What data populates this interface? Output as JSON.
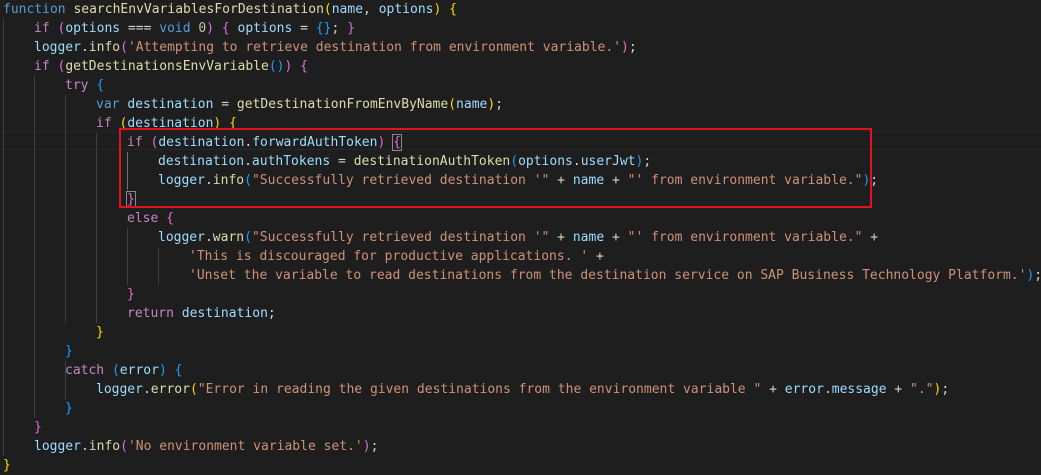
{
  "editor": {
    "theme": {
      "background": "#1e1e1e",
      "keyword": "#569cd6",
      "control": "#c586c0",
      "function": "#dcdcaa",
      "variable": "#9cdcfe",
      "string": "#ce9178",
      "number": "#b5cea8",
      "bracket_level_1": "#ffd700",
      "bracket_level_2": "#da70d6",
      "bracket_level_3": "#179fff",
      "annotation_box": "#e0141e"
    },
    "lines": [
      [
        [
          "kw",
          "function"
        ],
        [
          "p",
          " "
        ],
        [
          "fn",
          "searchEnvVariablesForDestination"
        ],
        [
          "b1",
          "("
        ],
        [
          "var",
          "name"
        ],
        [
          "p",
          ", "
        ],
        [
          "var",
          "options"
        ],
        [
          "b1",
          ")"
        ],
        [
          "p",
          " "
        ],
        [
          "b1",
          "{"
        ]
      ],
      [
        [
          "ctl",
          "if"
        ],
        [
          "p",
          " "
        ],
        [
          "b2",
          "("
        ],
        [
          "var",
          "options"
        ],
        [
          "p",
          " === "
        ],
        [
          "kw",
          "void"
        ],
        [
          "p",
          " "
        ],
        [
          "num",
          "0"
        ],
        [
          "b2",
          ")"
        ],
        [
          "p",
          " "
        ],
        [
          "b2",
          "{"
        ],
        [
          "p",
          " "
        ],
        [
          "var",
          "options"
        ],
        [
          "p",
          " = "
        ],
        [
          "b3",
          "{}"
        ],
        [
          "p",
          "; "
        ],
        [
          "b2",
          "}"
        ]
      ],
      [
        [
          "var",
          "logger"
        ],
        [
          "p",
          "."
        ],
        [
          "fn",
          "info"
        ],
        [
          "b2",
          "("
        ],
        [
          "str",
          "'Attempting to retrieve destination from environment variable.'"
        ],
        [
          "b2",
          ")"
        ],
        [
          "p",
          ";"
        ]
      ],
      [
        [
          "ctl",
          "if"
        ],
        [
          "p",
          " "
        ],
        [
          "b2",
          "("
        ],
        [
          "fn",
          "getDestinationsEnvVariable"
        ],
        [
          "b3",
          "()"
        ],
        [
          "b2",
          ")"
        ],
        [
          "p",
          " "
        ],
        [
          "b2",
          "{"
        ]
      ],
      [
        [
          "ctl",
          "try"
        ],
        [
          "p",
          " "
        ],
        [
          "b3",
          "{"
        ]
      ],
      [
        [
          "kw",
          "var"
        ],
        [
          "p",
          " "
        ],
        [
          "var",
          "destination"
        ],
        [
          "p",
          " = "
        ],
        [
          "fn",
          "getDestinationFromEnvByName"
        ],
        [
          "b1",
          "("
        ],
        [
          "var",
          "name"
        ],
        [
          "b1",
          ")"
        ],
        [
          "p",
          ";"
        ]
      ],
      [
        [
          "ctl",
          "if"
        ],
        [
          "p",
          " "
        ],
        [
          "b1",
          "("
        ],
        [
          "var",
          "destination"
        ],
        [
          "b1",
          ")"
        ],
        [
          "p",
          " "
        ],
        [
          "b1",
          "{"
        ]
      ],
      [
        [
          "ctl",
          "if"
        ],
        [
          "p",
          " "
        ],
        [
          "b2",
          "("
        ],
        [
          "var",
          "destination"
        ],
        [
          "p",
          "."
        ],
        [
          "var",
          "forwardAuthToken"
        ],
        [
          "b2",
          ")"
        ],
        [
          "p",
          " "
        ],
        [
          "b2",
          "{"
        ]
      ],
      [
        [
          "var",
          "destination"
        ],
        [
          "p",
          "."
        ],
        [
          "var",
          "authTokens"
        ],
        [
          "p",
          " = "
        ],
        [
          "fn",
          "destinationAuthToken"
        ],
        [
          "b3",
          "("
        ],
        [
          "var",
          "options"
        ],
        [
          "p",
          "."
        ],
        [
          "var",
          "userJwt"
        ],
        [
          "b3",
          ")"
        ],
        [
          "p",
          ";"
        ]
      ],
      [
        [
          "var",
          "logger"
        ],
        [
          "p",
          "."
        ],
        [
          "fn",
          "info"
        ],
        [
          "b3",
          "("
        ],
        [
          "str",
          "\"Successfully retrieved destination '\""
        ],
        [
          "p",
          " + "
        ],
        [
          "var",
          "name"
        ],
        [
          "p",
          " + "
        ],
        [
          "str",
          "\"' from environment variable.\""
        ],
        [
          "b3",
          ")"
        ],
        [
          "p",
          ";"
        ]
      ],
      [
        [
          "b2",
          "}"
        ]
      ],
      [
        [
          "ctl",
          "else"
        ],
        [
          "p",
          " "
        ],
        [
          "b2",
          "{"
        ]
      ],
      [
        [
          "var",
          "logger"
        ],
        [
          "p",
          "."
        ],
        [
          "fn",
          "warn"
        ],
        [
          "b3",
          "("
        ],
        [
          "str",
          "\"Successfully retrieved destination '\""
        ],
        [
          "p",
          " + "
        ],
        [
          "var",
          "name"
        ],
        [
          "p",
          " + "
        ],
        [
          "str",
          "\"' from environment variable.\""
        ],
        [
          "p",
          " +"
        ]
      ],
      [
        [
          "str",
          "'This is discouraged for productive applications. '"
        ],
        [
          "p",
          " +"
        ]
      ],
      [
        [
          "str",
          "'Unset the variable to read destinations from the destination service on SAP Business Technology Platform.'"
        ],
        [
          "b3",
          ")"
        ],
        [
          "p",
          ";"
        ]
      ],
      [
        [
          "b2",
          "}"
        ]
      ],
      [
        [
          "ctl",
          "return"
        ],
        [
          "p",
          " "
        ],
        [
          "var",
          "destination"
        ],
        [
          "p",
          ";"
        ]
      ],
      [
        [
          "b1",
          "}"
        ]
      ],
      [
        [
          "b3",
          "}"
        ]
      ],
      [
        [
          "ctl",
          "catch"
        ],
        [
          "p",
          " "
        ],
        [
          "b3",
          "("
        ],
        [
          "var",
          "error"
        ],
        [
          "b3",
          ")"
        ],
        [
          "p",
          " "
        ],
        [
          "b3",
          "{"
        ]
      ],
      [
        [
          "var",
          "logger"
        ],
        [
          "p",
          "."
        ],
        [
          "fn",
          "error"
        ],
        [
          "b1",
          "("
        ],
        [
          "str",
          "\"Error in reading the given destinations from the environment variable \""
        ],
        [
          "p",
          " + "
        ],
        [
          "var",
          "error"
        ],
        [
          "p",
          "."
        ],
        [
          "var",
          "message"
        ],
        [
          "p",
          " + "
        ],
        [
          "str",
          "\".\""
        ],
        [
          "b1",
          ")"
        ],
        [
          "p",
          ";"
        ]
      ],
      [
        [
          "b3",
          "}"
        ]
      ],
      [
        [
          "b2",
          "}"
        ]
      ],
      [
        [
          "var",
          "logger"
        ],
        [
          "p",
          "."
        ],
        [
          "fn",
          "info"
        ],
        [
          "b2",
          "("
        ],
        [
          "str",
          "'No environment variable set.'"
        ],
        [
          "b2",
          ")"
        ],
        [
          "p",
          ";"
        ]
      ],
      [
        [
          "b1",
          "}"
        ]
      ]
    ]
  }
}
